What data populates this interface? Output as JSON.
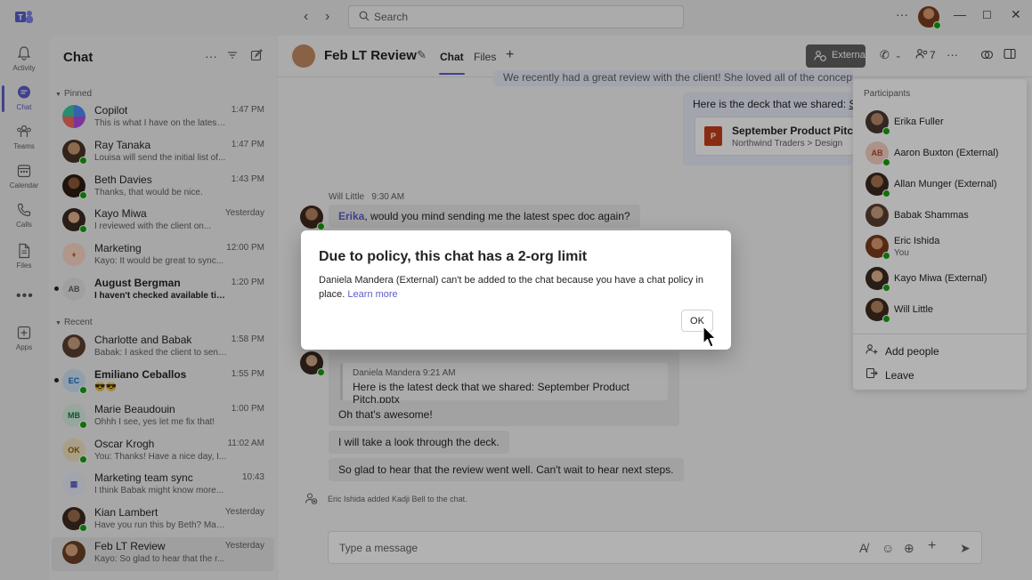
{
  "titlebar": {
    "search_placeholder": "Search",
    "more_label": "···"
  },
  "rail": [
    {
      "label": "Activity",
      "icon": "bell-icon"
    },
    {
      "label": "Chat",
      "icon": "chat-icon",
      "active": true
    },
    {
      "label": "Teams",
      "icon": "teams-icon"
    },
    {
      "label": "Calendar",
      "icon": "calendar-icon"
    },
    {
      "label": "Calls",
      "icon": "phone-icon"
    },
    {
      "label": "Files",
      "icon": "file-icon"
    },
    {
      "label": "Apps",
      "icon": "plus-square-icon"
    }
  ],
  "chatlist": {
    "title": "Chat",
    "pinned_label": "Pinned",
    "recent_label": "Recent",
    "pinned": [
      {
        "name": "Copilot",
        "time": "1:47 PM",
        "preview": "This is what I have on the latest o..."
      },
      {
        "name": "Ray Tanaka",
        "time": "1:47 PM",
        "preview": "Louisa will send the initial list of..."
      },
      {
        "name": "Beth Davies",
        "time": "1:43 PM",
        "preview": "Thanks, that would be nice."
      },
      {
        "name": "Kayo Miwa",
        "time": "Yesterday",
        "preview": "I reviewed with the client on..."
      },
      {
        "name": "Marketing",
        "time": "12:00 PM",
        "preview": "Kayo: It would be great to sync..."
      },
      {
        "name": "August Bergman",
        "initials": "AB",
        "time": "1:20 PM",
        "preview": "I haven't checked available time..."
      }
    ],
    "recent": [
      {
        "name": "Charlotte and Babak",
        "time": "1:58 PM",
        "preview": "Babak: I asked the client to send..."
      },
      {
        "name": "Emiliano Ceballos",
        "initials": "EC",
        "time": "1:55 PM",
        "preview": "😎😎"
      },
      {
        "name": "Marie Beaudouin",
        "initials": "MB",
        "time": "1:00 PM",
        "preview": "Ohhh I see, yes let me fix that!"
      },
      {
        "name": "Oscar Krogh",
        "initials": "OK",
        "time": "11:02 AM",
        "preview": "You: Thanks! Have a nice day, I..."
      },
      {
        "name": "Marketing team sync",
        "time": "10:43",
        "preview": "I think Babak might know more..."
      },
      {
        "name": "Kian Lambert",
        "time": "Yesterday",
        "preview": "Have you run this by Beth? Mak..."
      },
      {
        "name": "Feb LT Review",
        "time": "Yesterday",
        "preview": "Kayo: So glad to hear that the r..."
      }
    ]
  },
  "header": {
    "title": "Feb LT Review",
    "tabs": [
      "Chat",
      "Files"
    ],
    "external_label": "External",
    "participant_count": "7"
  },
  "messages": {
    "top_truncated": "We recently had a great review with the client! She loved all of the concepts tha",
    "deck_shared": "Here is the deck that we shared:",
    "deck_link": "Sep",
    "file_name": "September Product Pitch",
    "file_path": "Northwind Traders > Design",
    "will_sender": "Will Little",
    "will_time": "9:30 AM",
    "mention": "Erika",
    "will_text": ", would you mind sending me the latest spec doc again?",
    "quote_header": "Daniela Mandera   9:21 AM",
    "quote_text": "Here is the latest deck that we shared: September Product Pitch.pptx",
    "reply1": "Oh that's awesome!",
    "reply2": "I will take a look through the deck.",
    "reply3": "So glad to hear that the review went well. Can't wait to hear next steps.",
    "system": "Eric Ishida added Kadji Bell to the chat.",
    "composer_placeholder": "Type a message"
  },
  "participants": {
    "header": "Participants",
    "items": [
      {
        "name": "Erika Fuller"
      },
      {
        "name": "Aaron Buxton (External)",
        "initials": "AB"
      },
      {
        "name": "Allan Munger (External)"
      },
      {
        "name": "Babak Shammas"
      },
      {
        "name": "Eric Ishida",
        "sub": "You"
      },
      {
        "name": "Kayo Miwa (External)"
      },
      {
        "name": "Will Little"
      }
    ],
    "add_people": "Add people",
    "leave": "Leave"
  },
  "dialog": {
    "title": "Due to policy, this chat has a 2-org limit",
    "body": "Daniela Mandera (External) can't be added to the chat because you have a chat policy in place.",
    "link": "Learn more",
    "ok_label": "OK"
  },
  "colors": {
    "accent": "#5b5fc7",
    "presence": "#13a10e",
    "powerpoint": "#c43e1c"
  }
}
